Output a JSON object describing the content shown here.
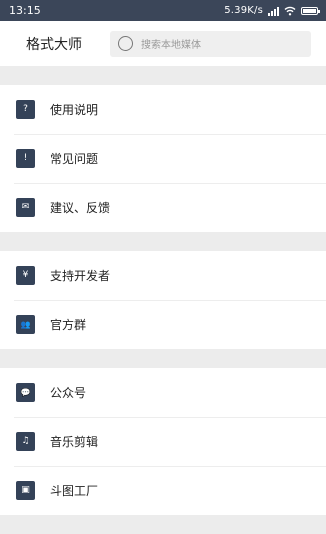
{
  "status_bar": {
    "time": "13:15",
    "network_speed": "5.39K/s"
  },
  "header": {
    "app_title": "格式大师",
    "search_placeholder": "搜索本地媒体"
  },
  "menu_groups": [
    {
      "items": [
        {
          "label": "使用说明",
          "icon": "question-icon",
          "glyph": "?"
        },
        {
          "label": "常见问题",
          "icon": "info-icon",
          "glyph": "!"
        },
        {
          "label": "建议、反馈",
          "icon": "mail-icon",
          "glyph": "✉"
        }
      ]
    },
    {
      "items": [
        {
          "label": "支持开发者",
          "icon": "yuan-icon",
          "glyph": "¥"
        },
        {
          "label": "官方群",
          "icon": "group-icon",
          "glyph": "👥"
        }
      ]
    },
    {
      "items": [
        {
          "label": "公众号",
          "icon": "wechat-icon",
          "glyph": "💬"
        },
        {
          "label": "音乐剪辑",
          "icon": "music-icon",
          "glyph": "♫"
        },
        {
          "label": "斗图工厂",
          "icon": "image-icon",
          "glyph": "▣"
        }
      ]
    }
  ]
}
